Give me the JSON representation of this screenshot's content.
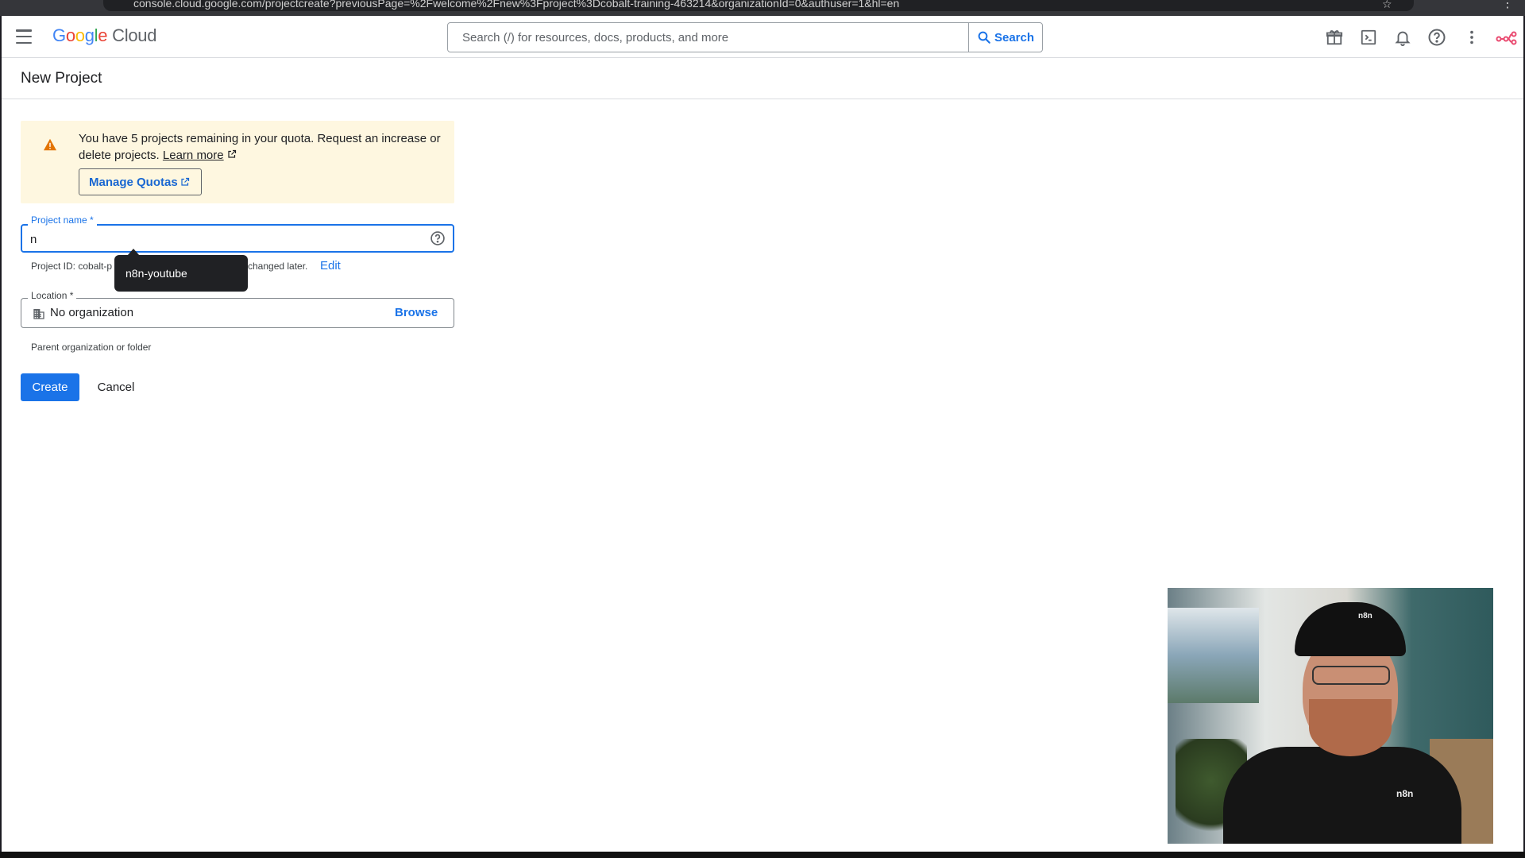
{
  "browser": {
    "url_text": "console.cloud.google.com/projectcreate?previousPage=%2Fwelcome%2Fnew%3Fproject%3Dcobalt-training-463214&organizationId=0&authuser=1&hl=en"
  },
  "header": {
    "logo_parts": [
      "G",
      "o",
      "o",
      "g",
      "l",
      "e"
    ],
    "logo_suffix": "Cloud",
    "search_placeholder": "Search (/) for resources, docs, products, and more",
    "search_button_label": "Search",
    "icons": [
      "gift-icon",
      "terminal-icon",
      "bell-icon",
      "help-icon",
      "more-vert-icon",
      "n8n-avatar-icon"
    ],
    "brand_colors": {
      "blue": "#4285f4",
      "red": "#ea4335",
      "yellow": "#fbbc04",
      "green": "#34a853",
      "accent": "#1a73e8"
    }
  },
  "page": {
    "title": "New Project"
  },
  "quota": {
    "message": "You have 5 projects remaining in your quota. Request an increase or delete projects.",
    "learn_more": "Learn more",
    "manage_quotas": "Manage Quotas",
    "warning_color": "#fef7e0"
  },
  "form": {
    "project_name_label": "Project name *",
    "project_name_value": "n",
    "project_id_prefix": "Project ID: cobalt-p",
    "project_id_suffix": "changed later.",
    "edit_label": "Edit",
    "autocomplete_suggestion": "n8n-youtube",
    "location_label": "Location *",
    "location_value": "No organization",
    "browse_label": "Browse",
    "location_helper": "Parent organization or folder",
    "create_label": "Create",
    "cancel_label": "Cancel"
  },
  "webcam": {
    "shirt_text": "n8n",
    "cap_text": "n8n"
  }
}
